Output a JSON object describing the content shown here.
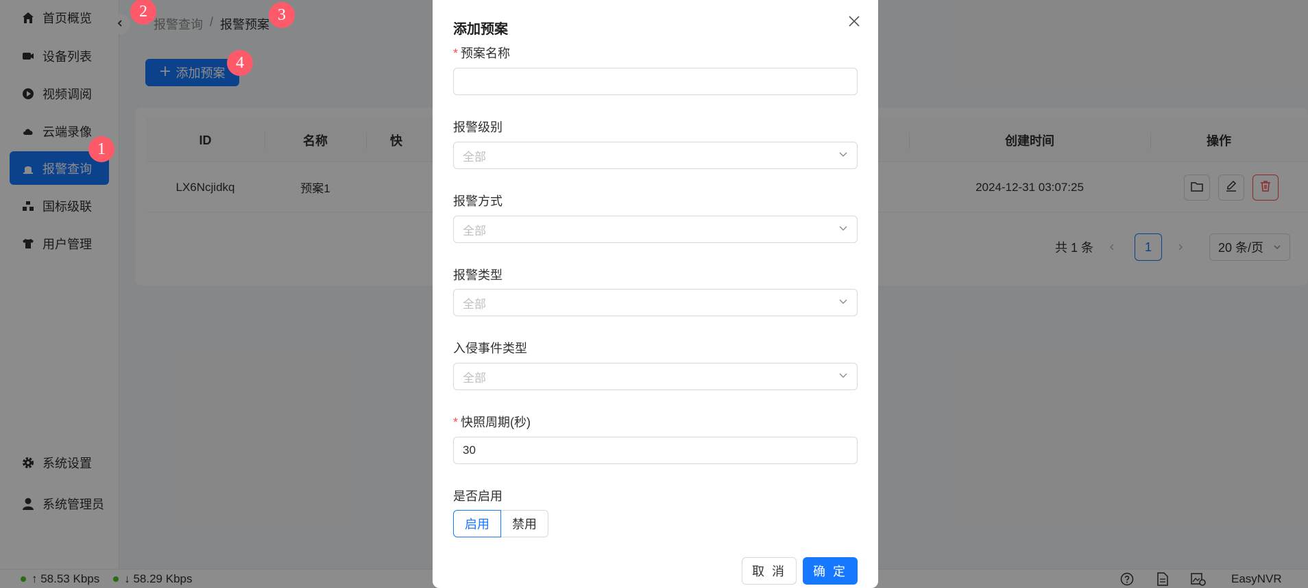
{
  "sidebar": {
    "items": [
      {
        "label": "首页概览",
        "icon": "home-icon"
      },
      {
        "label": "设备列表",
        "icon": "camera-icon"
      },
      {
        "label": "视频调阅",
        "icon": "play-circle-icon"
      },
      {
        "label": "云端录像",
        "icon": "cloud-icon"
      },
      {
        "label": "报警查询",
        "icon": "alarm-icon",
        "active": true
      },
      {
        "label": "国标级联",
        "icon": "cascade-icon"
      },
      {
        "label": "用户管理",
        "icon": "shirt-icon"
      }
    ],
    "bottom_items": [
      {
        "label": "系统设置",
        "icon": "gear-icon"
      },
      {
        "label": "系统管理员",
        "icon": "user-icon"
      }
    ]
  },
  "breadcrumb": {
    "parent": "报警查询",
    "separator": "/",
    "current": "报警预案"
  },
  "toolbar": {
    "add_label": "添加预案"
  },
  "table": {
    "columns": [
      "ID",
      "名称",
      "快",
      "创建时间",
      "操作"
    ],
    "rows": [
      {
        "id": "LX6Ncjidkq",
        "name": "预案1",
        "created": "2024-12-31 03:07:25"
      }
    ]
  },
  "pagination": {
    "total_label": "共 1 条",
    "current_page": "1",
    "page_size": "20 条/页"
  },
  "statusbar": {
    "upload": "↑ 58.53 Kbps",
    "download": "↓ 58.29 Kbps",
    "brand": "EasyNVR"
  },
  "modal": {
    "title": "添加预案",
    "fields": {
      "name_label": "预案名称",
      "level_label": "报警级别",
      "level_value": "全部",
      "method_label": "报警方式",
      "method_value": "全部",
      "type_label": "报警类型",
      "type_value": "全部",
      "intrusion_label": "入侵事件类型",
      "intrusion_value": "全部",
      "snapshot_label": "快照周期(秒)",
      "snapshot_value": "30",
      "enable_label": "是否启用",
      "enable_on": "启用",
      "enable_off": "禁用"
    },
    "cancel_label": "取 消",
    "ok_label": "确 定"
  },
  "markers": [
    "1",
    "2",
    "3",
    "4"
  ],
  "colors": {
    "primary": "#1677ff",
    "danger": "#ff4d4f",
    "marker": "#ff5a6a",
    "online": "#52c41a"
  }
}
